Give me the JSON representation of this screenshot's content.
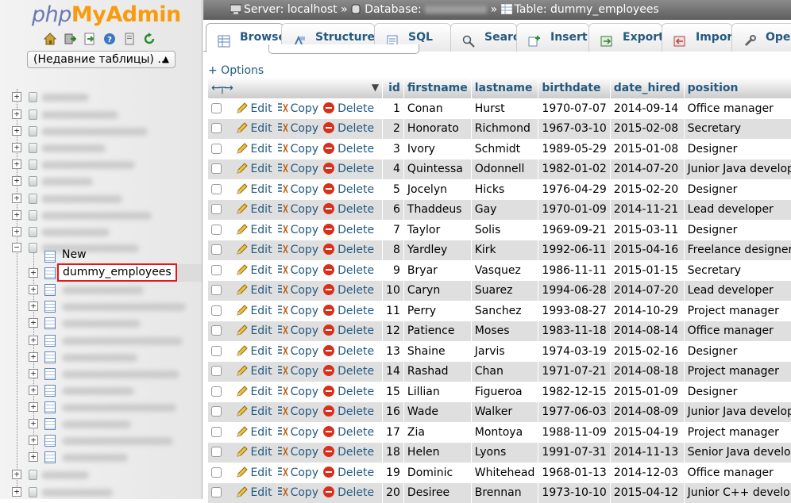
{
  "logo": {
    "php": "php",
    "my": "My",
    "admin": "Admin"
  },
  "nav": {
    "recent_tables": "(Недавние таблицы) ...",
    "new_label": "New",
    "selected_table": "dummy_employees",
    "icons": [
      "home-icon",
      "exit-icon",
      "sql-query-icon",
      "help-icon",
      "docs-icon",
      "reload-icon"
    ]
  },
  "breadcrumb": {
    "server": "Server: localhost",
    "sep1": "»",
    "database": "Database:",
    "sep2": "»",
    "table": "Table: dummy_employees"
  },
  "tabs": [
    {
      "label": "Browse",
      "icon": "browse-icon",
      "active": true
    },
    {
      "label": "Structure",
      "icon": "structure-icon"
    },
    {
      "label": "SQL",
      "icon": "sql-icon"
    },
    {
      "label": "Search",
      "icon": "search-icon"
    },
    {
      "label": "Insert",
      "icon": "insert-icon"
    },
    {
      "label": "Export",
      "icon": "export-icon"
    },
    {
      "label": "Import",
      "icon": "import-icon"
    },
    {
      "label": "Oper",
      "icon": "operations-icon"
    }
  ],
  "options_link": "+ Options",
  "grid": {
    "columns": [
      "id",
      "firstname",
      "lastname",
      "birthdate",
      "date_hired",
      "position"
    ],
    "actions": {
      "edit": "Edit",
      "copy": "Copy",
      "delete": "Delete"
    },
    "rows": [
      [
        "1",
        "Conan",
        "Hurst",
        "1970-07-07",
        "2014-09-14",
        "Office manager"
      ],
      [
        "2",
        "Honorato",
        "Richmond",
        "1967-03-10",
        "2015-02-08",
        "Secretary"
      ],
      [
        "3",
        "Ivory",
        "Schmidt",
        "1989-05-29",
        "2015-01-08",
        "Designer"
      ],
      [
        "4",
        "Quintessa",
        "Odonnell",
        "1982-01-02",
        "2014-07-20",
        "Junior Java developer"
      ],
      [
        "5",
        "Jocelyn",
        "Hicks",
        "1976-04-29",
        "2015-02-20",
        "Designer"
      ],
      [
        "6",
        "Thaddeus",
        "Gay",
        "1970-01-09",
        "2014-11-21",
        "Lead developer"
      ],
      [
        "7",
        "Taylor",
        "Solis",
        "1969-09-21",
        "2015-03-11",
        "Designer"
      ],
      [
        "8",
        "Yardley",
        "Kirk",
        "1992-06-11",
        "2015-04-16",
        "Freelance designer"
      ],
      [
        "9",
        "Bryar",
        "Vasquez",
        "1986-11-11",
        "2015-01-15",
        "Secretary"
      ],
      [
        "10",
        "Caryn",
        "Suarez",
        "1994-06-28",
        "2014-07-20",
        "Lead developer"
      ],
      [
        "11",
        "Perry",
        "Sanchez",
        "1993-08-27",
        "2014-10-29",
        "Project manager"
      ],
      [
        "12",
        "Patience",
        "Moses",
        "1983-11-18",
        "2014-08-14",
        "Office manager"
      ],
      [
        "13",
        "Shaine",
        "Jarvis",
        "1974-03-19",
        "2015-02-16",
        "Designer"
      ],
      [
        "14",
        "Rashad",
        "Chan",
        "1971-07-21",
        "2014-08-18",
        "Project manager"
      ],
      [
        "15",
        "Lillian",
        "Figueroa",
        "1982-12-15",
        "2015-01-09",
        "Designer"
      ],
      [
        "16",
        "Wade",
        "Walker",
        "1977-06-03",
        "2014-08-09",
        "Junior Java developer"
      ],
      [
        "17",
        "Zia",
        "Montoya",
        "1988-11-09",
        "2015-04-19",
        "Project manager"
      ],
      [
        "18",
        "Helen",
        "Lyons",
        "1991-07-31",
        "2014-11-13",
        "Senior Java developer"
      ],
      [
        "19",
        "Dominic",
        "Whitehead",
        "1968-01-13",
        "2014-12-03",
        "Office manager"
      ],
      [
        "20",
        "Desiree",
        "Brennan",
        "1973-10-10",
        "2015-04-12",
        "Junior C++ developer"
      ]
    ]
  },
  "colors": {
    "link": "#235a81",
    "breadcrumb_bg": "#6f6f6f",
    "even_row": "#dfdfdf",
    "highlight_border": "#e0191b",
    "logo_orange": "#f89c0e",
    "logo_blue": "#6c78af"
  }
}
